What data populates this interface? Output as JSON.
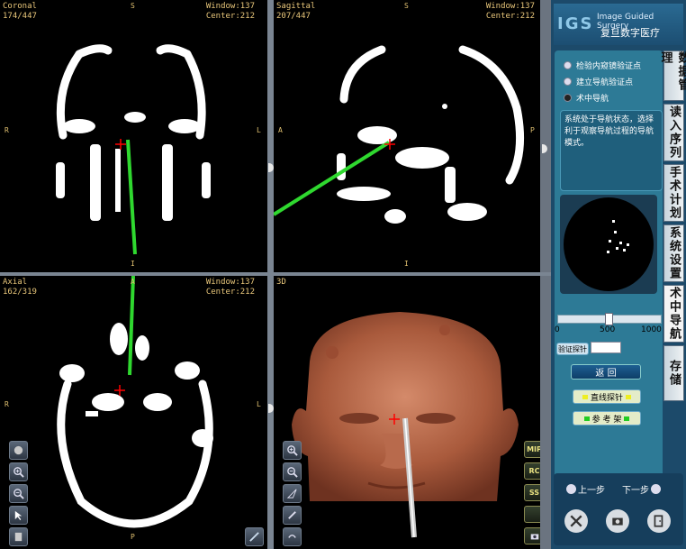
{
  "views": {
    "coronal": {
      "name": "Coronal",
      "slice": "174/447",
      "window": "Window:137",
      "center": "Center:212",
      "top": "S",
      "bottom": "I",
      "left": "R",
      "right": "L"
    },
    "sagittal": {
      "name": "Sagittal",
      "slice": "207/447",
      "window": "Window:137",
      "center": "Center:212",
      "top": "S",
      "bottom": "I",
      "left": "A",
      "right": "P"
    },
    "axial": {
      "name": "Axial",
      "slice": "162/319",
      "window": "Window:137",
      "center": "Center:212",
      "top": "A",
      "bottom": "P",
      "left": "R",
      "right": "L"
    },
    "threed": {
      "name": "3D"
    }
  },
  "render_tools": {
    "mip": "MIP",
    "rc": "RC",
    "ss": "SS"
  },
  "panel": {
    "logo": "IGS",
    "logo_en": "Image Guided Surgery",
    "logo_cn": "复旦数字医疗",
    "tabs": [
      "数据管理",
      "读入序列",
      "手术计划",
      "系统设置",
      "术中导航",
      "存储"
    ],
    "radio": [
      "检验内窥镜验证点",
      "建立导航验证点",
      "术中导航"
    ],
    "status_msg": "系统处于导航状态，选择利于观察导航过程的导航模式。",
    "slider_labels": [
      "0",
      "500",
      "1000"
    ],
    "slider_value": 490,
    "verify_label": "验证探针",
    "return_label": "返  回",
    "straight_probe": "直线探针",
    "reference_frame": "参 考 架",
    "prev_step": "上一步",
    "next_step": "下一步"
  }
}
